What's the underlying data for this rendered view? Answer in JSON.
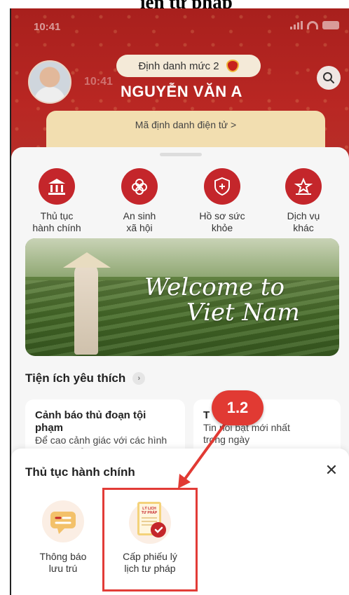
{
  "document": {
    "heading": "iện tư pháp"
  },
  "status_bar": {
    "time": "10:41"
  },
  "profile": {
    "ghost_time": "10:41",
    "level_label": "Định danh mức 2",
    "name": "NGUYỄN VĂN A",
    "id_card_label": "Mã định danh điện tử  >"
  },
  "quick_actions": [
    {
      "label": "Thủ tục\nhành chính",
      "icon": "temple-icon"
    },
    {
      "label": "An sinh\nxã hội",
      "icon": "flower-icon"
    },
    {
      "label": "Hồ sơ sức\nkhỏe",
      "icon": "health-shield-icon"
    },
    {
      "label": "Dịch vụ\nkhác",
      "icon": "more-services-icon"
    }
  ],
  "banner": {
    "line1": "Welcome to",
    "line2": "Viet Nam"
  },
  "favorites": {
    "title": "Tiện ích yêu thích",
    "cards": [
      {
        "title": "Cảnh báo thủ đoạn tội phạm",
        "desc": "Để cao cảnh giác với các hình thức lừa đảo"
      },
      {
        "title": "T",
        "desc": "Tin   nổi bật mới nhất\ntrong ngày"
      }
    ]
  },
  "modal": {
    "title": "Thủ tục hành chính",
    "close_label": "✕",
    "services": [
      {
        "label": "Thông báo\nlưu trú",
        "icon": "notification-message-icon"
      },
      {
        "label": "Cấp phiếu lý\nlịch tư pháp",
        "icon": "judicial-record-icon",
        "doc_text": "LÝ LỊCH\nTƯ PHÁP"
      }
    ]
  },
  "annotation": {
    "step": "1.2",
    "color": "#e13a33"
  },
  "colors": {
    "brand_red": "#b92723",
    "accent_gold": "#f2deb0"
  }
}
